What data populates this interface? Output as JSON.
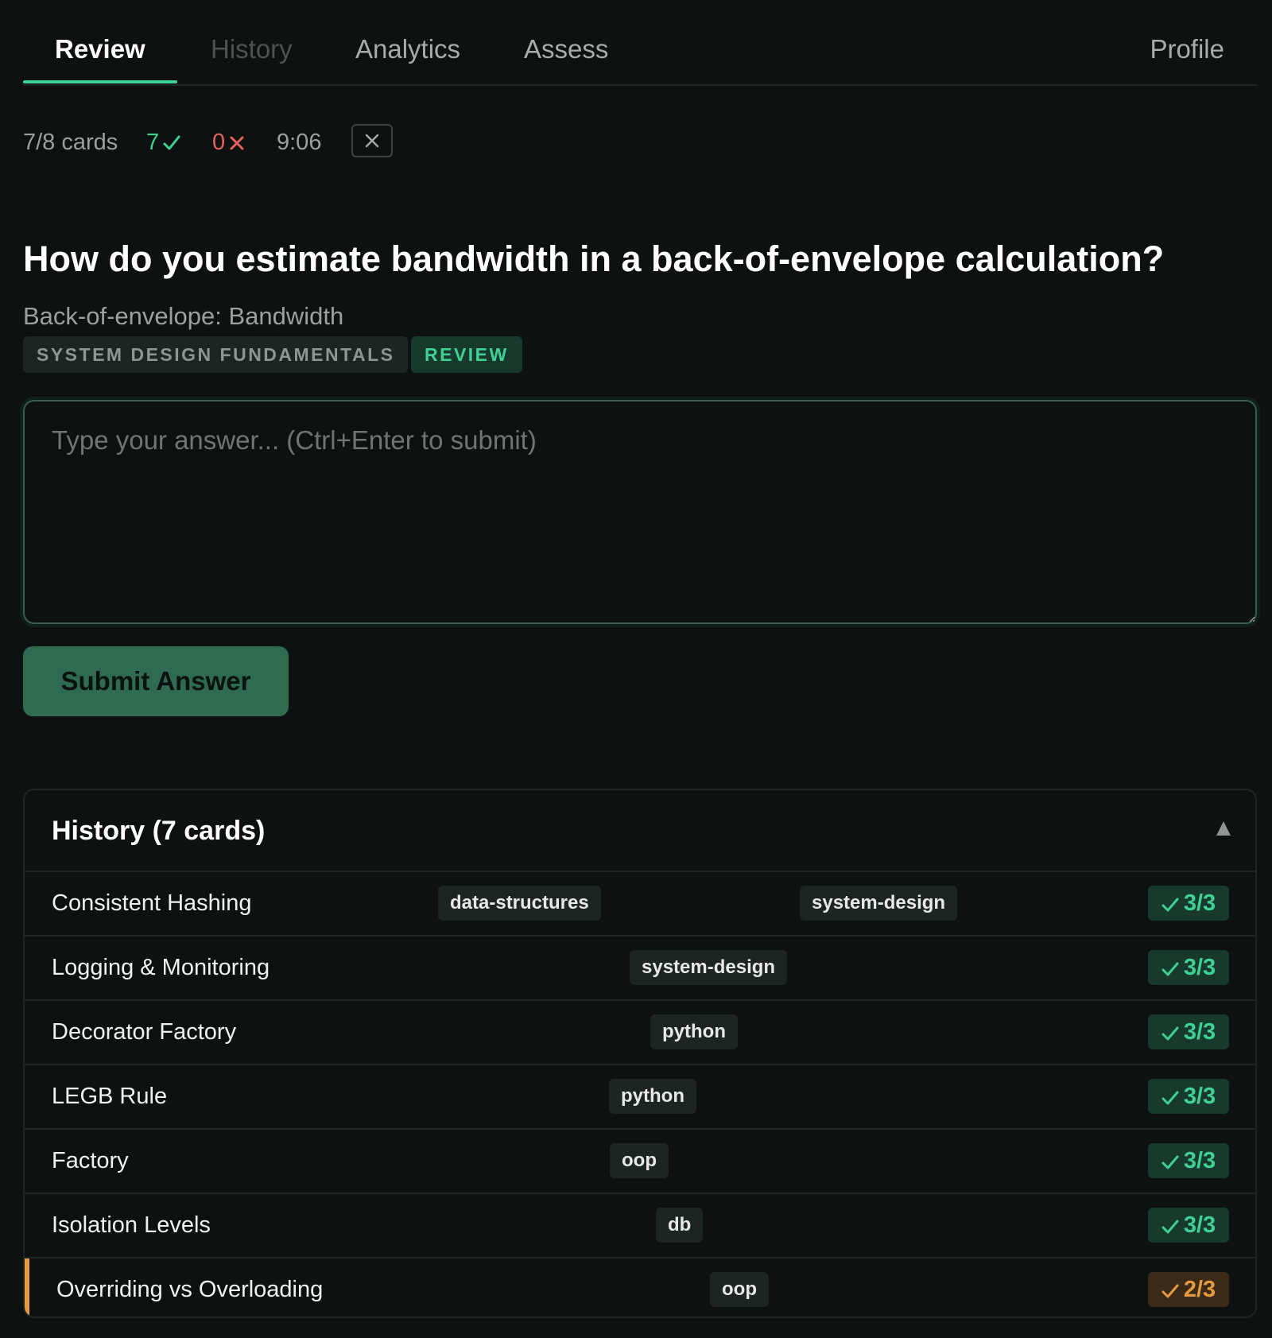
{
  "nav": {
    "tabs": [
      {
        "label": "Review",
        "active": true
      },
      {
        "label": "History",
        "active": false
      },
      {
        "label": "Analytics",
        "active": false
      },
      {
        "label": "Assess",
        "active": false
      }
    ],
    "profile_label": "Profile"
  },
  "session": {
    "progress": "7/8 cards",
    "correct": "7",
    "wrong": "0",
    "timer": "9:06"
  },
  "card": {
    "question": "How do you estimate bandwidth in a back-of-envelope calculation?",
    "topic": "Back-of-envelope: Bandwidth",
    "category": "SYSTEM DESIGN FUNDAMENTALS",
    "mode": "REVIEW"
  },
  "answer": {
    "placeholder": "Type your answer... (Ctrl+Enter to submit)",
    "value": ""
  },
  "submit_label": "Submit Answer",
  "history": {
    "title": "History (7 cards)",
    "rows": [
      {
        "title": "Consistent Hashing",
        "tags": [
          "data-structures",
          "system-design"
        ],
        "score": "3/3",
        "status": "correct"
      },
      {
        "title": "Logging & Monitoring",
        "tags": [
          "system-design"
        ],
        "score": "3/3",
        "status": "correct"
      },
      {
        "title": "Decorator Factory",
        "tags": [
          "python"
        ],
        "score": "3/3",
        "status": "correct"
      },
      {
        "title": "LEGB Rule",
        "tags": [
          "python"
        ],
        "score": "3/3",
        "status": "correct"
      },
      {
        "title": "Factory",
        "tags": [
          "oop"
        ],
        "score": "3/3",
        "status": "correct"
      },
      {
        "title": "Isolation Levels",
        "tags": [
          "db"
        ],
        "score": "3/3",
        "status": "correct"
      },
      {
        "title": "Overriding vs Overloading",
        "tags": [
          "oop"
        ],
        "score": "2/3",
        "status": "partial"
      }
    ]
  },
  "colors": {
    "accent": "#3fd194",
    "error": "#e5625c",
    "partial": "#e59a3f",
    "background": "#0d1110"
  }
}
